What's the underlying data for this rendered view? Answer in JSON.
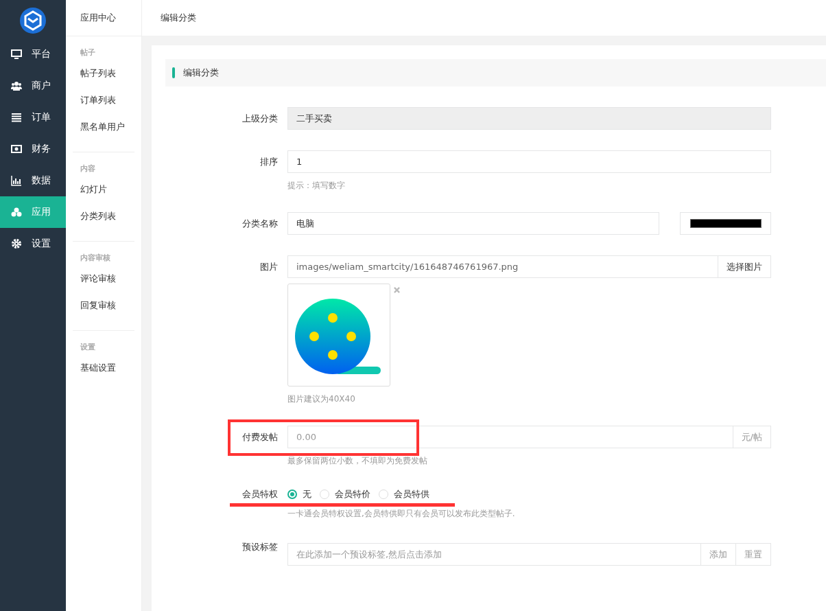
{
  "main_nav": [
    {
      "label": "平台",
      "selected": false
    },
    {
      "label": "商户",
      "selected": false
    },
    {
      "label": "订单",
      "selected": false
    },
    {
      "label": "财务",
      "selected": false
    },
    {
      "label": "数据",
      "selected": false
    },
    {
      "label": "应用",
      "selected": true
    },
    {
      "label": "设置",
      "selected": false
    }
  ],
  "sub_nav": {
    "title": "应用中心",
    "groups": [
      {
        "heading": "帖子",
        "items": [
          "帖子列表",
          "订单列表",
          "黑名单用户"
        ]
      },
      {
        "heading": "内容",
        "items": [
          "幻灯片",
          "分类列表"
        ]
      },
      {
        "heading": "内容审核",
        "items": [
          "评论审核",
          "回复审核"
        ]
      },
      {
        "heading": "设置",
        "items": [
          "基础设置"
        ]
      }
    ]
  },
  "breadcrumb": "编辑分类",
  "panel_title": "编辑分类",
  "form": [
    {
      "kind": "readonly",
      "label": "上级分类",
      "value": "二手买卖"
    },
    {
      "kind": "text",
      "label": "排序",
      "value": "1",
      "hint": "提示：填写数字"
    },
    {
      "kind": "color_text",
      "label": "分类名称",
      "value": "电脑"
    },
    {
      "kind": "image",
      "label": "图片",
      "value": "images/weliam_smartcity/161648746761967.png",
      "button": "选择图片",
      "hint": "图片建议为40X40"
    },
    {
      "kind": "addon",
      "label": "付费发帖",
      "placeholder": "0.00",
      "addon": "元/帖",
      "hint": "最多保留两位小数，不填即为免费发帖"
    },
    {
      "kind": "radio",
      "label": "会员特权",
      "options": [
        {
          "label": "无",
          "selected": true
        },
        {
          "label": "会员特价",
          "selected": false
        },
        {
          "label": "会员特供",
          "selected": false
        }
      ],
      "hint": "一卡通会员特权设置,会员特供即只有会员可以发布此类型帖子."
    },
    {
      "kind": "tags",
      "label": "预设标签",
      "placeholder": "在此添加一个预设标签,然后点击添加",
      "buttons": [
        "添加",
        "重置"
      ]
    }
  ]
}
